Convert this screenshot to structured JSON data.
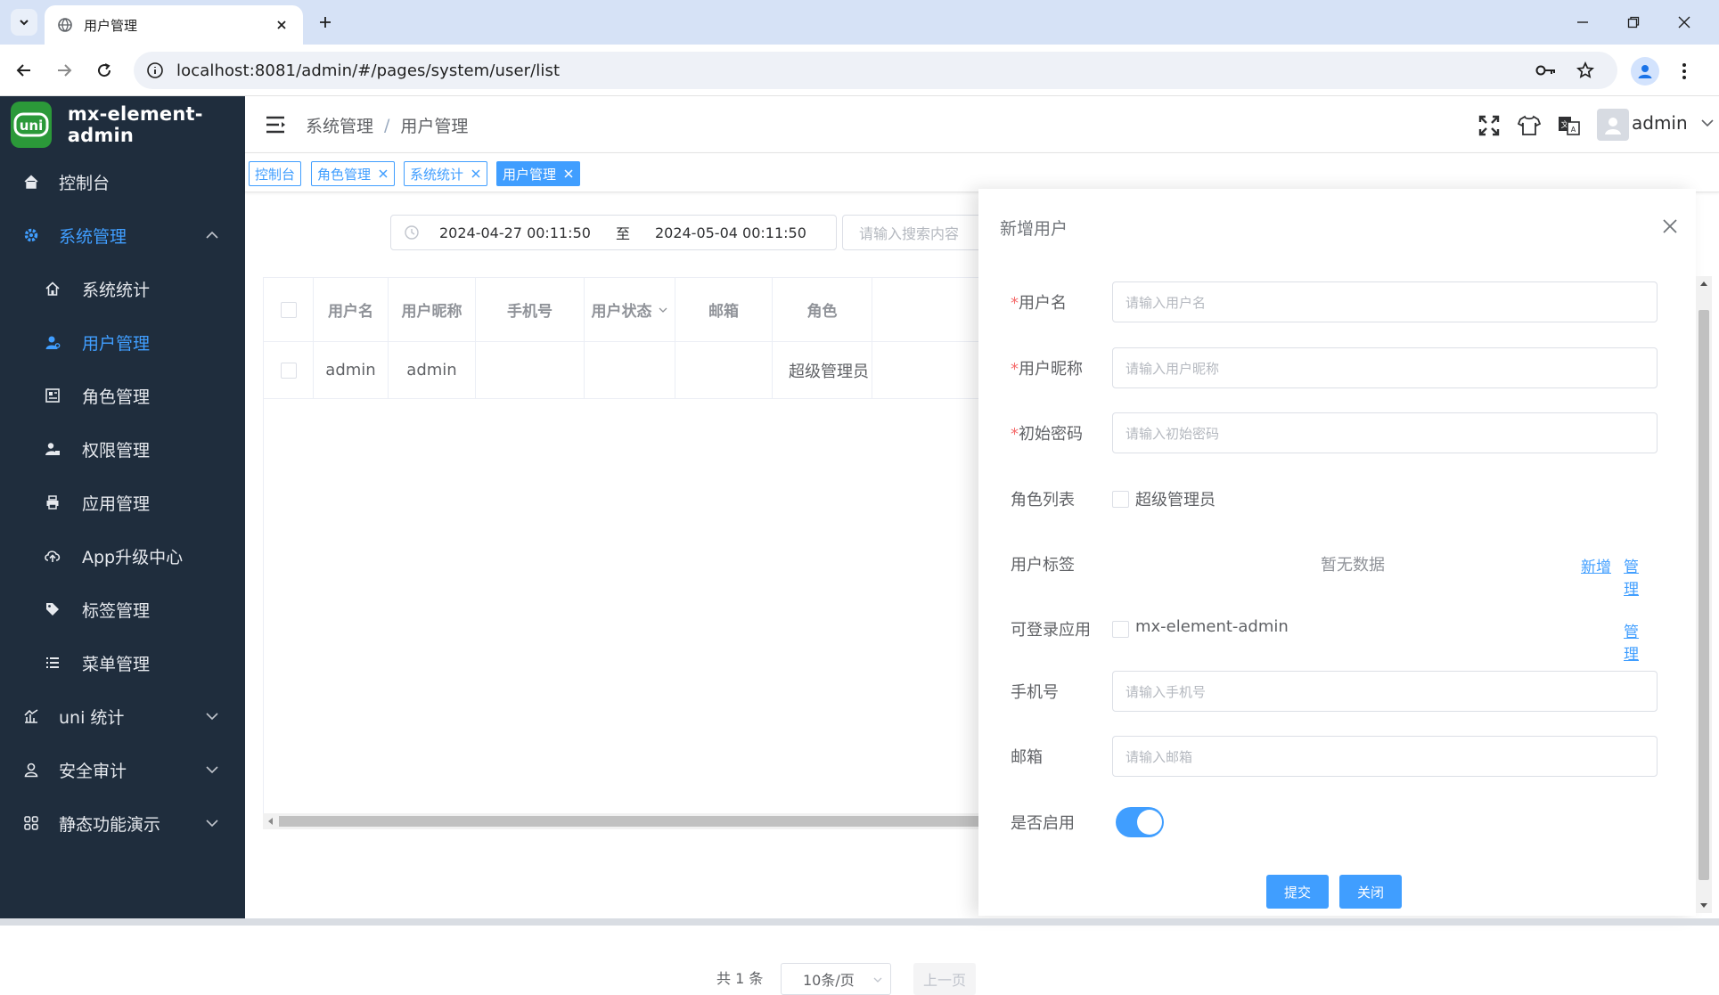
{
  "browser": {
    "tab_title": "用户管理",
    "url": "localhost:8081/admin/#/pages/system/user/list"
  },
  "app": {
    "name": "mx-element-admin",
    "logo_text": "uni"
  },
  "sidebar": {
    "items": [
      {
        "label": "控制台",
        "icon": "home-icon"
      },
      {
        "label": "系统管理",
        "icon": "gear-icon"
      },
      {
        "label": "系统统计",
        "icon": "house-icon"
      },
      {
        "label": "用户管理",
        "icon": "user-icon"
      },
      {
        "label": "角色管理",
        "icon": "form-icon"
      },
      {
        "label": "权限管理",
        "icon": "user-lock-icon"
      },
      {
        "label": "应用管理",
        "icon": "printer-icon"
      },
      {
        "label": "App升级中心",
        "icon": "cloud-upload-icon"
      },
      {
        "label": "标签管理",
        "icon": "tag-icon"
      },
      {
        "label": "菜单管理",
        "icon": "list-icon"
      },
      {
        "label": "uni 统计",
        "icon": "chart-icon"
      },
      {
        "label": "安全审计",
        "icon": "user-outline-icon"
      },
      {
        "label": "静态功能演示",
        "icon": "grid-icon"
      }
    ]
  },
  "header": {
    "breadcrumb": [
      "系统管理",
      "用户管理"
    ],
    "username": "admin"
  },
  "tags": [
    {
      "label": "控制台"
    },
    {
      "label": "角色管理"
    },
    {
      "label": "系统统计"
    },
    {
      "label": "用户管理"
    }
  ],
  "filters": {
    "start": "2024-04-27 00:11:50",
    "to": "至",
    "end": "2024-05-04 00:11:50",
    "search_placeholder": "请输入搜索内容"
  },
  "table": {
    "columns": [
      "用户名",
      "用户昵称",
      "手机号",
      "用户状态",
      "邮箱",
      "角色"
    ],
    "rows": [
      [
        "admin",
        "admin",
        "",
        "",
        "",
        "超级管理员"
      ]
    ]
  },
  "pagination": {
    "total": "共 1 条",
    "page_size": "10条/页",
    "prev": "上一页"
  },
  "drawer": {
    "title": "新增用户",
    "fields": {
      "username_label": "用户名",
      "username_placeholder": "请输入用户名",
      "nickname_label": "用户昵称",
      "nickname_placeholder": "请输入用户昵称",
      "password_label": "初始密码",
      "password_placeholder": "请输入初始密码",
      "roles_label": "角色列表",
      "role_option": "超级管理员",
      "tags_label": "用户标签",
      "tags_empty": "暂无数据",
      "tags_add": "新增",
      "tags_manage": "管理",
      "apps_label": "可登录应用",
      "app_option": "mx-element-admin",
      "apps_manage": "管理",
      "mobile_label": "手机号",
      "mobile_placeholder": "请输入手机号",
      "email_label": "邮箱",
      "email_placeholder": "请输入邮箱",
      "enabled_label": "是否启用",
      "enabled": true
    },
    "submit": "提交",
    "close": "关闭"
  },
  "colors": {
    "sidebar_bg": "#1f2d3d",
    "accent": "#409eff",
    "required": "#f56c6c"
  }
}
